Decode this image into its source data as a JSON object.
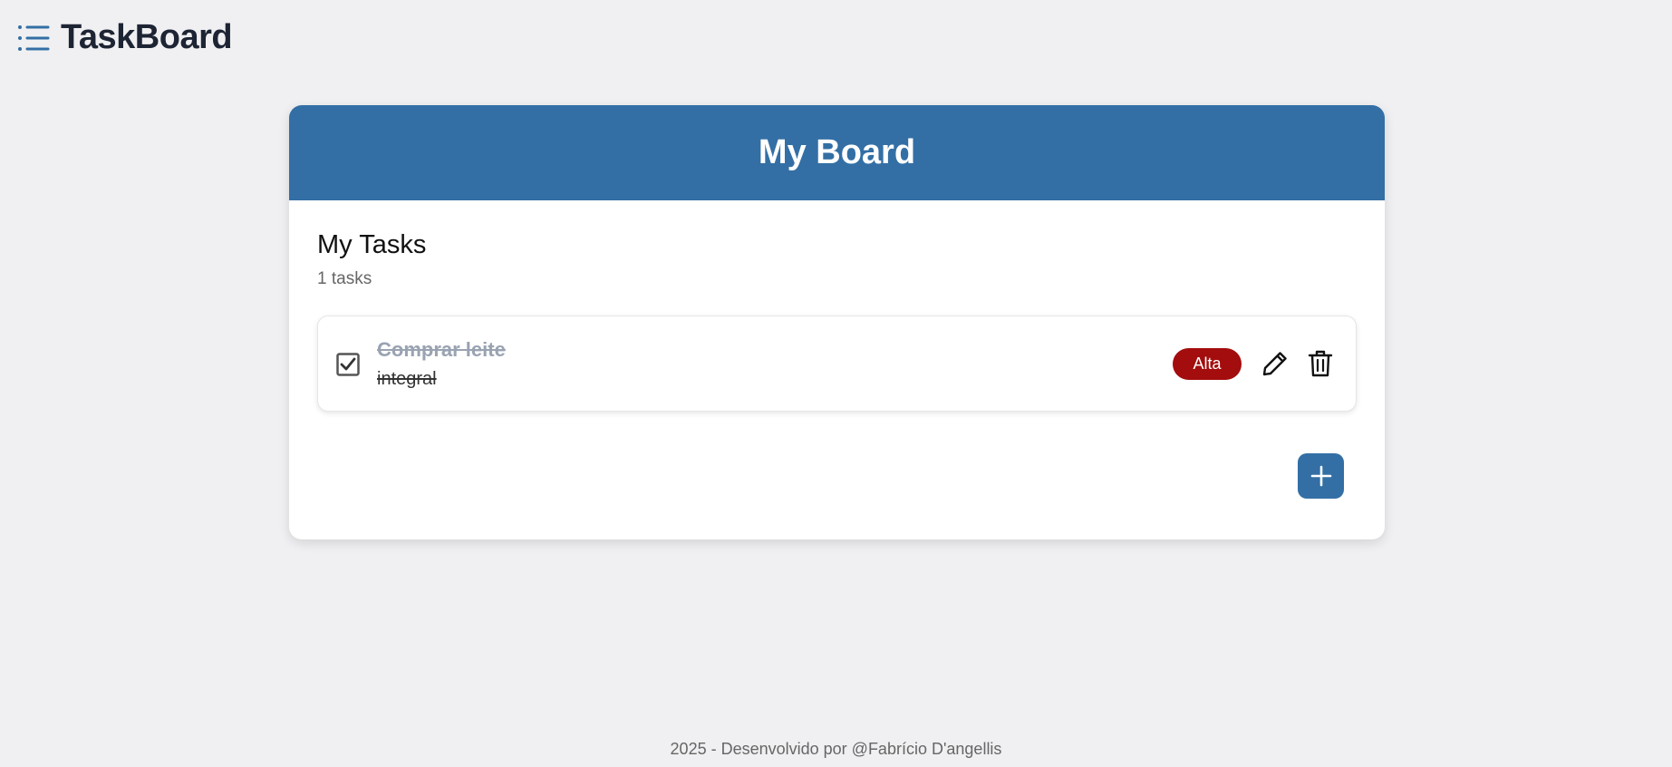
{
  "app": {
    "title": "TaskBoard",
    "menu_icon": "list-icon"
  },
  "board": {
    "title": "My Board",
    "header_color": "#336fa5",
    "section_title": "My Tasks",
    "task_count": "1 tasks",
    "tasks": [
      {
        "title": "Comprar leite",
        "description": "integral",
        "completed": true,
        "priority": "Alta",
        "priority_color": "#a30d0d",
        "edit_icon": "pencil-icon",
        "delete_icon": "trash-icon"
      }
    ],
    "add_icon": "plus-icon"
  },
  "footer": {
    "text": "2025 - Desenvolvido por @Fabrício D'angellis"
  }
}
